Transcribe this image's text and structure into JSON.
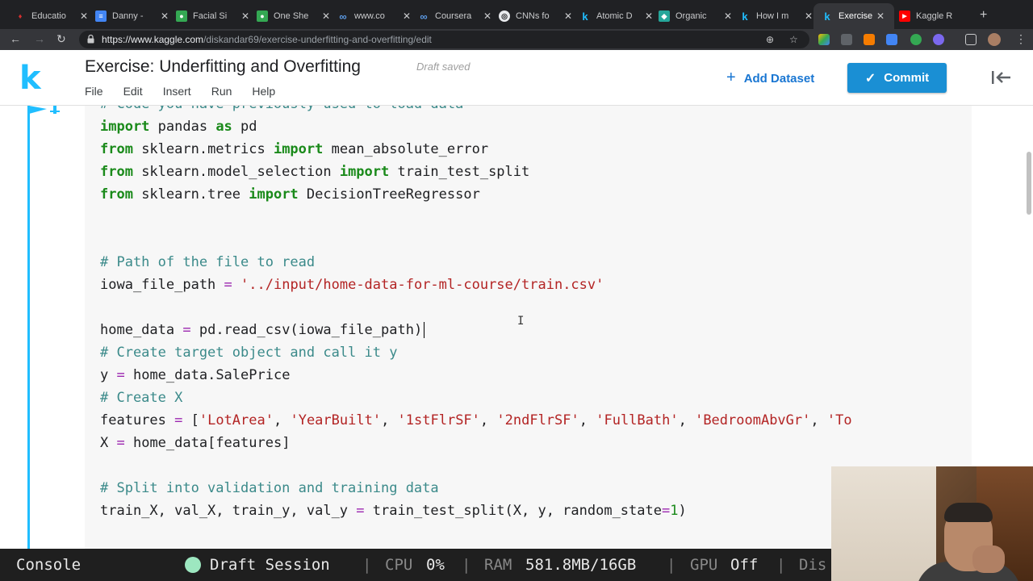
{
  "browser": {
    "tabs": [
      {
        "label": "Educatio",
        "icon": "red-logo-icon",
        "color": "#d32f2f"
      },
      {
        "label": "Danny -",
        "icon": "google-docs-icon",
        "color": "#4285f4"
      },
      {
        "label": "Facial Si",
        "icon": "green-app-icon",
        "color": "#34a853"
      },
      {
        "label": "One She",
        "icon": "green-app-icon",
        "color": "#34a853"
      },
      {
        "label": "www.co",
        "icon": "infinity-icon",
        "color": "#5c9be6"
      },
      {
        "label": "Coursera",
        "icon": "infinity-icon",
        "color": "#5c9be6"
      },
      {
        "label": "CNNs fo",
        "icon": "globe-icon",
        "color": "#e8eaed"
      },
      {
        "label": "Atomic D",
        "icon": "kaggle-icon",
        "color": "#20beff"
      },
      {
        "label": "Organic",
        "icon": "cube-icon",
        "color": "#26a69a"
      },
      {
        "label": "How I m",
        "icon": "kaggle-icon",
        "color": "#20beff"
      },
      {
        "label": "Exercise",
        "icon": "kaggle-icon",
        "color": "#20beff",
        "active": true
      },
      {
        "label": "Kaggle R",
        "icon": "youtube-icon",
        "color": "#ff0000"
      }
    ],
    "url_host": "https://www.kaggle.com",
    "url_path": "/diskandar69/exercise-underfitting-and-overfitting/edit"
  },
  "kaggle": {
    "logo": "k",
    "title": "Exercise: Underfitting and Overfitting",
    "draft_status": "Draft saved",
    "menu": [
      "File",
      "Edit",
      "Insert",
      "Run",
      "Help"
    ],
    "add_dataset": "Add Dataset",
    "commit": "Commit",
    "accent": "#20beff"
  },
  "code": {
    "partial_top": "# Code you have previously used to load data",
    "lines": {
      "l1": {
        "kw": "import",
        "a": " pandas ",
        "kw2": "as",
        "b": " pd"
      },
      "l2": {
        "kw": "from",
        "a": " sklearn.metrics ",
        "kw2": "import",
        "b": " mean_absolute_error"
      },
      "l3": {
        "kw": "from",
        "a": " sklearn.model_selection ",
        "kw2": "import",
        "b": " train_test_split"
      },
      "l4": {
        "kw": "from",
        "a": " sklearn.tree ",
        "kw2": "import",
        "b": " DecisionTreeRegressor"
      },
      "l5": {
        "cm": "# Path of the file to read"
      },
      "l6": {
        "a": "iowa_file_path ",
        "op": "=",
        "b": " ",
        "st": "'../input/home-data-for-ml-course/train.csv'"
      },
      "l7": {
        "a": "home_data ",
        "op": "=",
        "b": " pd.read_csv(iowa_file_path)"
      },
      "l8": {
        "cm": "# Create target object and call it y"
      },
      "l9": {
        "a": "y ",
        "op": "=",
        "b": " home_data.SalePrice"
      },
      "l10": {
        "cm": "# Create X"
      },
      "l11": {
        "a": "features ",
        "op": "=",
        "b": " [",
        "s1": "'LotArea'",
        "c1": ", ",
        "s2": "'YearBuilt'",
        "c2": ", ",
        "s3": "'1stFlrSF'",
        "c3": ", ",
        "s4": "'2ndFlrSF'",
        "c4": ", ",
        "s5": "'FullBath'",
        "c5": ", ",
        "s6": "'BedroomAbvGr'",
        "c6": ", ",
        "s7": "'To"
      },
      "l12": {
        "a": "X ",
        "op": "=",
        "b": " home_data[features]"
      },
      "l13": {
        "cm": "# Split into validation and training data"
      },
      "l14": {
        "a": "train_X, val_X, train_y, val_y ",
        "op": "=",
        "b": " train_test_split(X, y, random_state",
        "op2": "=",
        "num": "1",
        "c": ")"
      }
    }
  },
  "status": {
    "console": "Console",
    "session": "Draft Session",
    "cpu_label": "CPU",
    "cpu_value": "0%",
    "ram_label": "RAM",
    "ram_value": "581.8MB/16GB",
    "gpu_label": "GPU",
    "gpu_value": "Off",
    "disk_label": "Dis",
    "sep": "|"
  }
}
